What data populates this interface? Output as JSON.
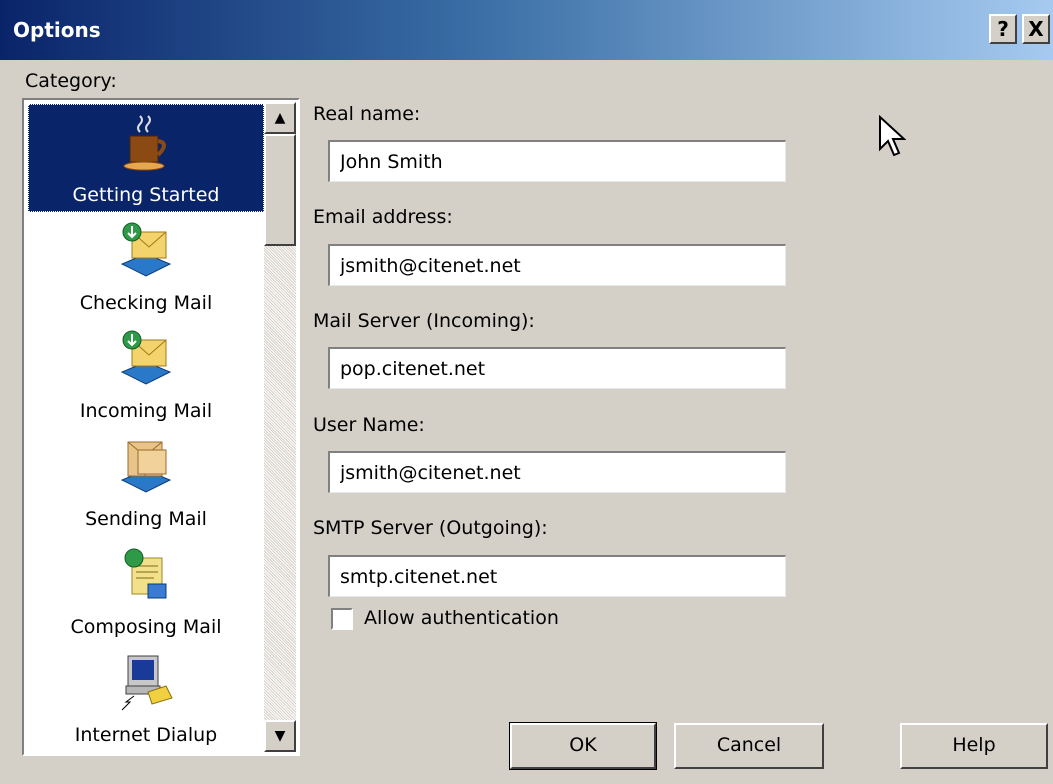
{
  "window": {
    "title": "Options",
    "help_button": "?",
    "close_button": "X"
  },
  "category": {
    "label": "Category:",
    "items": [
      {
        "label": "Getting Started",
        "icon": "coffee-cup-icon",
        "selected": true
      },
      {
        "label": "Checking Mail",
        "icon": "mail-envelope-icon",
        "selected": false
      },
      {
        "label": "Incoming Mail",
        "icon": "mail-envelope-icon",
        "selected": false
      },
      {
        "label": "Sending Mail",
        "icon": "send-mail-icon",
        "selected": false
      },
      {
        "label": "Composing Mail",
        "icon": "compose-mail-icon",
        "selected": false
      },
      {
        "label": "Internet Dialup",
        "icon": "dialup-computer-icon",
        "selected": false
      }
    ]
  },
  "form": {
    "real_name_label": "Real name:",
    "real_name_value": "John Smith",
    "email_label": "Email address:",
    "email_value": "jsmith@citenet.net",
    "incoming_label": "Mail Server (Incoming):",
    "incoming_value": "pop.citenet.net",
    "username_label": "User Name:",
    "username_value": "jsmith@citenet.net",
    "smtp_label": "SMTP Server (Outgoing):",
    "smtp_value": "smtp.citenet.net",
    "auth_label": "Allow authentication",
    "auth_checked": false
  },
  "buttons": {
    "ok": "OK",
    "cancel": "Cancel",
    "help": "Help"
  },
  "colors": {
    "face": "#d4d0c8",
    "title_start": "#0a246a",
    "title_end": "#a6caf0",
    "selection": "#0a246a"
  }
}
